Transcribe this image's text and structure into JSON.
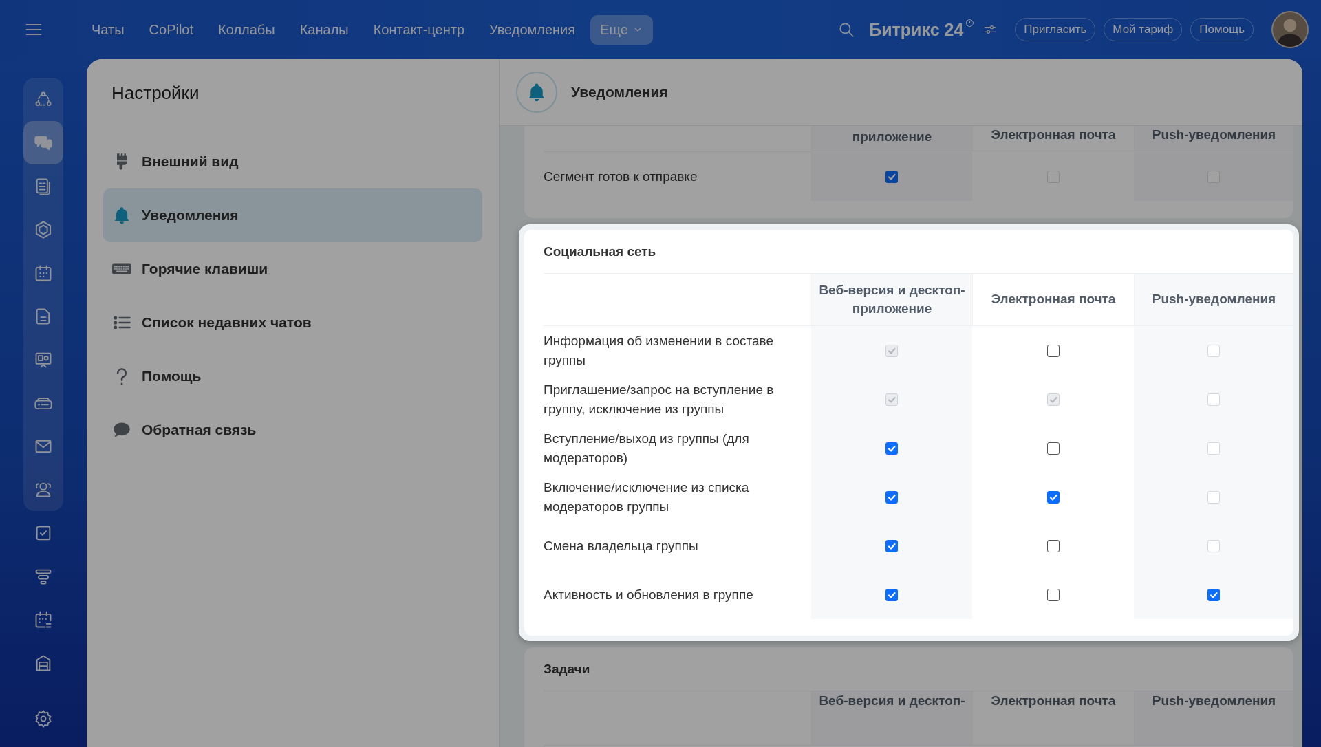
{
  "top_nav": {
    "items": [
      {
        "label": "Чаты",
        "selected": false
      },
      {
        "label": "CoPilot",
        "selected": false
      },
      {
        "label": "Коллабы",
        "selected": false
      },
      {
        "label": "Каналы",
        "selected": false
      },
      {
        "label": "Контакт-центр",
        "selected": false
      },
      {
        "label": "Уведомления",
        "selected": false
      },
      {
        "label": "Еще",
        "selected": true
      }
    ],
    "logo": "Битрикс 24",
    "buttons": [
      "Пригласить",
      "Мой тариф",
      "Помощь"
    ]
  },
  "rail": {
    "pinned": [
      {
        "kind": "flow",
        "selected": false
      },
      {
        "kind": "chats",
        "selected": true
      },
      {
        "kind": "feed",
        "selected": false
      },
      {
        "kind": "hexagon",
        "selected": false
      },
      {
        "kind": "calendar",
        "selected": false
      },
      {
        "kind": "document",
        "selected": false
      },
      {
        "kind": "board",
        "selected": false
      },
      {
        "kind": "drive",
        "selected": false
      },
      {
        "kind": "mail",
        "selected": false
      },
      {
        "kind": "people",
        "selected": false
      }
    ],
    "items": [
      {
        "kind": "tasks",
        "selected": false
      },
      {
        "kind": "funnel",
        "selected": false
      },
      {
        "kind": "schedule",
        "selected": false
      },
      {
        "kind": "warehouse",
        "selected": false
      }
    ],
    "footer": [
      {
        "kind": "settings",
        "selected": false
      }
    ]
  },
  "settings": {
    "title": "Настройки",
    "items": [
      {
        "label": "Внешний вид",
        "kind": "brush",
        "selected": false
      },
      {
        "label": "Уведомления",
        "kind": "bell",
        "selected": true
      },
      {
        "label": "Горячие клавиши",
        "kind": "keyboard",
        "selected": false
      },
      {
        "label": "Список недавних чатов",
        "kind": "list",
        "selected": false
      },
      {
        "label": "Помощь",
        "kind": "question",
        "selected": false
      },
      {
        "label": "Обратная связь",
        "kind": "chat",
        "selected": false
      }
    ]
  },
  "header": {
    "title": "Уведомления"
  },
  "sections": [
    {
      "highlighted": false,
      "columns": [
        "приложение",
        "Электронная почта",
        "Push-уведомления"
      ],
      "rows": [
        {
          "label": "Сегмент готов к отправке",
          "cells": [
            {
              "checked": true,
              "disabled": false
            },
            {
              "checked": false,
              "disabled": true
            },
            {
              "checked": false,
              "disabled": true
            }
          ]
        }
      ]
    },
    {
      "highlighted": true,
      "title": "Социальная сеть",
      "columns": [
        "Веб-версия и десктоп-приложение",
        "Электронная почта",
        "Push-уведомления"
      ],
      "rows": [
        {
          "label": "Информация об изменении в составе группы",
          "cells": [
            {
              "checked": true,
              "disabled": true
            },
            {
              "checked": false,
              "disabled": false
            },
            {
              "checked": false,
              "disabled": true
            }
          ]
        },
        {
          "label": "Приглашение/запрос на вступление в группу, исключение из группы",
          "cells": [
            {
              "checked": true,
              "disabled": true
            },
            {
              "checked": true,
              "disabled": true
            },
            {
              "checked": false,
              "disabled": true
            }
          ]
        },
        {
          "label": "Вступление/выход из группы (для модераторов)",
          "cells": [
            {
              "checked": true,
              "disabled": false
            },
            {
              "checked": false,
              "disabled": false
            },
            {
              "checked": false,
              "disabled": true
            }
          ]
        },
        {
          "label": "Включение/исключение из списка модераторов группы",
          "cells": [
            {
              "checked": true,
              "disabled": false
            },
            {
              "checked": true,
              "disabled": false
            },
            {
              "checked": false,
              "disabled": true
            }
          ]
        },
        {
          "label": "Смена владельца группы",
          "cells": [
            {
              "checked": true,
              "disabled": false
            },
            {
              "checked": false,
              "disabled": false
            },
            {
              "checked": false,
              "disabled": true
            }
          ]
        },
        {
          "label": "Активность и обновления в группе",
          "cells": [
            {
              "checked": true,
              "disabled": false
            },
            {
              "checked": false,
              "disabled": false
            },
            {
              "checked": true,
              "disabled": false
            }
          ]
        }
      ]
    },
    {
      "highlighted": false,
      "title": "Задачи",
      "columns": [
        "Веб-версия и десктоп-",
        "Электронная почта",
        "Push-уведомления"
      ]
    }
  ]
}
